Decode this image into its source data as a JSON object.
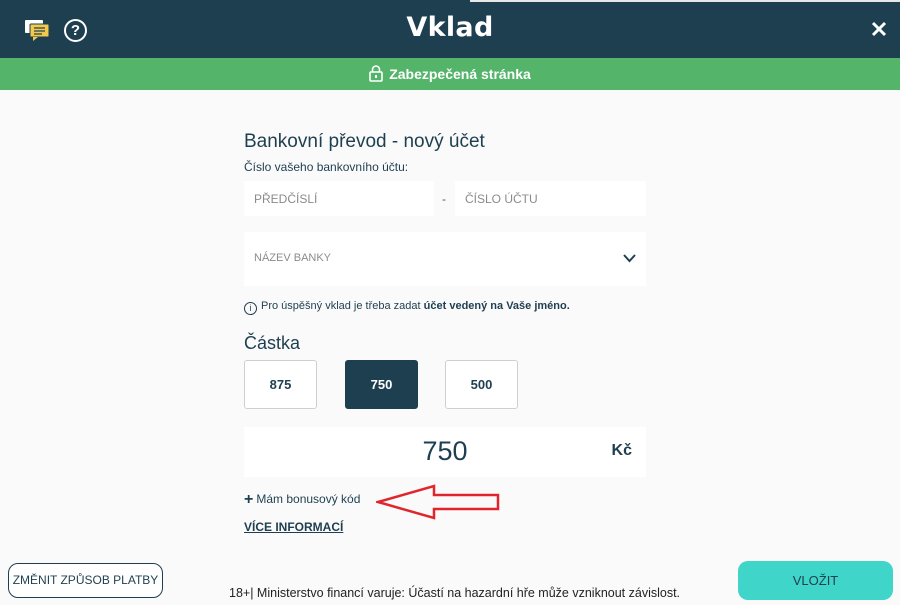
{
  "header": {
    "title": "Vklad",
    "icons": {
      "chat": "chat-icon",
      "help": "help-icon",
      "close": "close-icon"
    },
    "help_glyph": "?",
    "background": "#1e3f50"
  },
  "secure_bar": {
    "text": "Zabezpečená stránka",
    "icon": "lock-icon",
    "background": "#53b46a"
  },
  "form": {
    "heading": "Bankovní převod - nový účet",
    "account_label": "Číslo vašeho bankovního účtu:",
    "prefix_placeholder": "PŘEDČÍSLÍ",
    "separator": "-",
    "account_placeholder": "ČÍSLO ÚČTU",
    "bank_placeholder": "NÁZEV BANKY",
    "info_glyph": "i",
    "info_text": "Pro úspěšný vklad je třeba zadat",
    "info_bold": "účet vedený na Vaše jméno.",
    "amount_label": "Částka",
    "amount_options": [
      "875",
      "750",
      "500"
    ],
    "selected_amount": "750",
    "amount_value": "750",
    "currency": "Kč",
    "bonus_plus": "+",
    "bonus_label": "Mám bonusový kód",
    "more_info": "VÍCE INFORMACÍ"
  },
  "footer": {
    "change_button": "ZMĚNIT ZPŮSOB PLATBY",
    "warning": "18+| Ministerstvo financí varuje: Účastí na hazardní hře může vzniknout závislost.",
    "submit_button": "VLOŽIT",
    "submit_color": "#3fd5c8"
  },
  "annotation": {
    "arrow_color": "#e0262d"
  }
}
